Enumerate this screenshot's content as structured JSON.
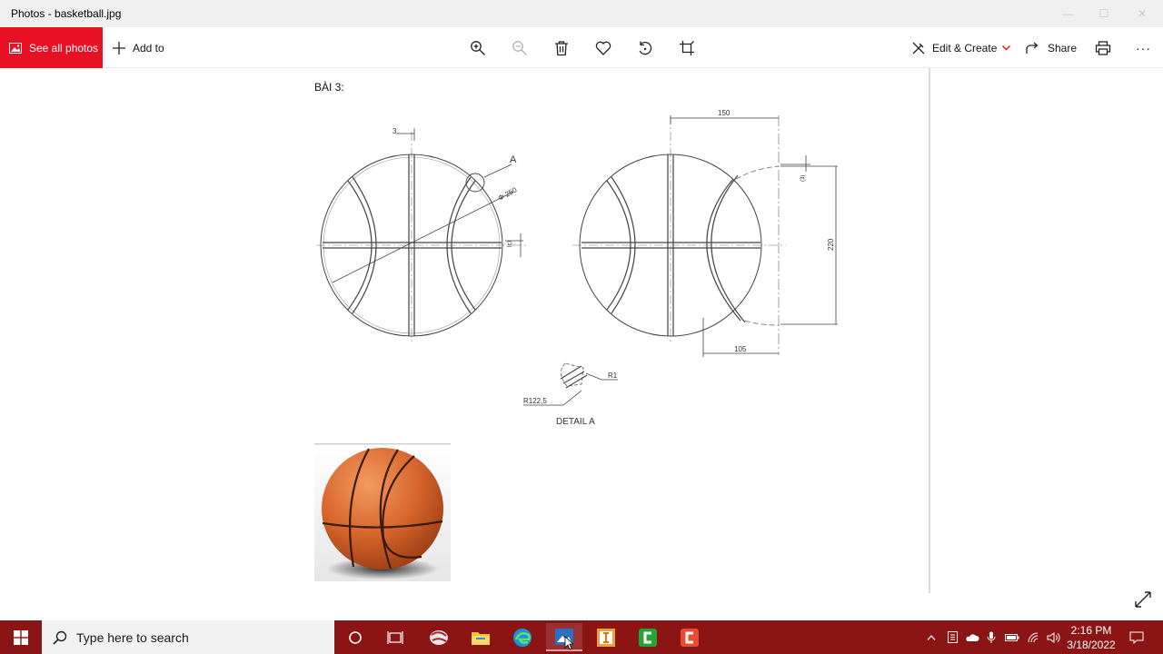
{
  "window": {
    "title": "Photos - basketball.jpg",
    "minimize": "—",
    "maximize": "☐",
    "close": "✕"
  },
  "toolbar": {
    "see_all_photos": "See all photos",
    "add_to": "Add to",
    "edit_create": "Edit & Create",
    "share": "Share",
    "more": "···",
    "accent_color": "#e81123"
  },
  "document": {
    "heading": "BÀI 3:",
    "dim_3": "3",
    "label_a": "A",
    "dim_diameter": "Φ 250",
    "dim_side_3": "(3)",
    "dim_150": "150",
    "dim_side_3b": "(3)",
    "dim_220": "220",
    "dim_105": "105",
    "dim_r1": "R1",
    "dim_r1225": "R122,5",
    "detail_a": "DETAIL  A"
  },
  "taskbar": {
    "search_placeholder": "Type here to search",
    "time": "2:16 PM",
    "date": "3/18/2022",
    "color": "#8b1515"
  }
}
